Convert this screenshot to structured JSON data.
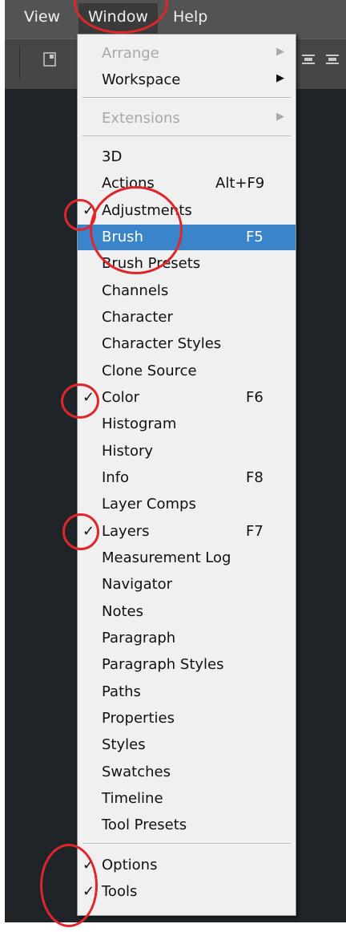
{
  "menubar": {
    "items": [
      {
        "label": "View"
      },
      {
        "label": "Window"
      },
      {
        "label": "Help"
      }
    ]
  },
  "toolbar": {
    "icons": [
      "panel-icon",
      "align-icon",
      "distribute-icon"
    ]
  },
  "window_menu": {
    "top_items": [
      {
        "label": "Arrange",
        "submenu": true,
        "enabled": false
      },
      {
        "label": "Workspace",
        "submenu": true,
        "enabled": true
      }
    ],
    "extensions": {
      "label": "Extensions",
      "submenu": true,
      "enabled": false
    },
    "panels": [
      {
        "label": "3D",
        "shortcut": "",
        "checked": false
      },
      {
        "label": "Actions",
        "shortcut": "Alt+F9",
        "checked": false
      },
      {
        "label": "Adjustments",
        "shortcut": "",
        "checked": true
      },
      {
        "label": "Brush",
        "shortcut": "F5",
        "checked": false,
        "highlighted": true
      },
      {
        "label": "Brush Presets",
        "shortcut": "",
        "checked": false
      },
      {
        "label": "Channels",
        "shortcut": "",
        "checked": false
      },
      {
        "label": "Character",
        "shortcut": "",
        "checked": false
      },
      {
        "label": "Character Styles",
        "shortcut": "",
        "checked": false
      },
      {
        "label": "Clone Source",
        "shortcut": "",
        "checked": false
      },
      {
        "label": "Color",
        "shortcut": "F6",
        "checked": true
      },
      {
        "label": "Histogram",
        "shortcut": "",
        "checked": false
      },
      {
        "label": "History",
        "shortcut": "",
        "checked": false
      },
      {
        "label": "Info",
        "shortcut": "F8",
        "checked": false
      },
      {
        "label": "Layer Comps",
        "shortcut": "",
        "checked": false
      },
      {
        "label": "Layers",
        "shortcut": "F7",
        "checked": true
      },
      {
        "label": "Measurement Log",
        "shortcut": "",
        "checked": false
      },
      {
        "label": "Navigator",
        "shortcut": "",
        "checked": false
      },
      {
        "label": "Notes",
        "shortcut": "",
        "checked": false
      },
      {
        "label": "Paragraph",
        "shortcut": "",
        "checked": false
      },
      {
        "label": "Paragraph Styles",
        "shortcut": "",
        "checked": false
      },
      {
        "label": "Paths",
        "shortcut": "",
        "checked": false
      },
      {
        "label": "Properties",
        "shortcut": "",
        "checked": false
      },
      {
        "label": "Styles",
        "shortcut": "",
        "checked": false
      },
      {
        "label": "Swatches",
        "shortcut": "",
        "checked": false
      },
      {
        "label": "Timeline",
        "shortcut": "",
        "checked": false
      },
      {
        "label": "Tool Presets",
        "shortcut": "",
        "checked": false
      }
    ],
    "bottom_items": [
      {
        "label": "Options",
        "shortcut": "",
        "checked": true
      },
      {
        "label": "Tools",
        "shortcut": "",
        "checked": true
      }
    ]
  },
  "glyphs": {
    "check": "✓",
    "arrow": "▶"
  },
  "colors": {
    "highlight": "#3a84c9",
    "annotation_ring": "#e0262b",
    "menubar": "#535353",
    "menu_bg": "#f0f0f0"
  }
}
